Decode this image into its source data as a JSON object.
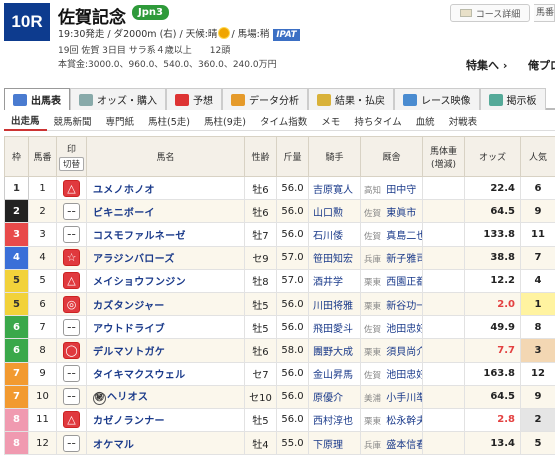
{
  "race": {
    "number": "10R",
    "name": "佐賀記念",
    "grade": "Jpn3",
    "info_line1": "19:30発走 / ダ2000m (右) / 天候:晴",
    "track": "/ 馬場:稍",
    "ipat": "IPAT",
    "info_line2": "19回 佐賀 3日目 サラ系４歳以上　　12頭",
    "info_line3": "本賞金:3000.0、960.0、540.0、360.0、240.0万円"
  },
  "buttons": {
    "course": "コース詳細",
    "umaban": "馬番",
    "tokushu": "特集へ",
    "ore": "俺プロ"
  },
  "tabs": [
    {
      "label": "出馬表",
      "color": "#4a7bd0"
    },
    {
      "label": "オッズ・購入",
      "color": "#8aa"
    },
    {
      "label": "予想",
      "color": "#d33"
    },
    {
      "label": "データ分析",
      "color": "#e59a2a"
    },
    {
      "label": "結果・払戻",
      "color": "#d9b23a"
    },
    {
      "label": "レース映像",
      "color": "#4a8bd0"
    },
    {
      "label": "掲示板",
      "color": "#5a9"
    }
  ],
  "subtabs": [
    "出走馬",
    "競馬新聞",
    "専門紙",
    "馬柱(5走)",
    "馬柱(9走)",
    "タイム指数",
    "メモ",
    "持ちタイム",
    "血統",
    "対戦表"
  ],
  "columns": {
    "waku": "枠",
    "umaban": "馬番",
    "mark": "印",
    "mark_sub": "切替",
    "horse": "馬名",
    "sex_age": "性齢",
    "weight": "斤量",
    "jockey": "騎手",
    "trainer": "厩舎",
    "body": "馬体重",
    "body_sub": "(増減)",
    "odds": "オッズ",
    "pop": "人気"
  },
  "entries": [
    {
      "waku": "1",
      "umaban": "1",
      "mark": "△",
      "mark_red": true,
      "tag": "",
      "horse": "ユメノホノオ",
      "sex_age": "牡6",
      "weight": "56.0",
      "jockey": "吉原寛人",
      "area": "高知",
      "trainer": "田中守",
      "odds": "22.4",
      "odds_red": false,
      "pop": "6",
      "wcolor": "#ffffff",
      "wtext": "#333"
    },
    {
      "waku": "2",
      "umaban": "2",
      "mark": "--",
      "mark_red": false,
      "tag": "",
      "horse": "ビキニボーイ",
      "sex_age": "牡6",
      "weight": "56.0",
      "jockey": "山口勲",
      "area": "佐賀",
      "trainer": "東眞市",
      "odds": "64.5",
      "odds_red": false,
      "pop": "9",
      "wcolor": "#222222",
      "wtext": "#fff"
    },
    {
      "waku": "3",
      "umaban": "3",
      "mark": "--",
      "mark_red": false,
      "tag": "",
      "horse": "コスモファルネーゼ",
      "sex_age": "牡7",
      "weight": "56.0",
      "jockey": "石川倭",
      "area": "佐賀",
      "trainer": "真島二也",
      "odds": "133.8",
      "odds_red": false,
      "pop": "11",
      "wcolor": "#e84a4a",
      "wtext": "#fff"
    },
    {
      "waku": "4",
      "umaban": "4",
      "mark": "☆",
      "mark_red": true,
      "tag": "",
      "horse": "アラジンバローズ",
      "sex_age": "セ9",
      "weight": "57.0",
      "jockey": "笹田知宏",
      "area": "兵庫",
      "trainer": "新子雅司",
      "odds": "38.8",
      "odds_red": false,
      "pop": "7",
      "wcolor": "#3a6fd8",
      "wtext": "#fff"
    },
    {
      "waku": "5",
      "umaban": "5",
      "mark": "△",
      "mark_red": true,
      "tag": "",
      "horse": "メイショウフンジン",
      "sex_age": "牡8",
      "weight": "57.0",
      "jockey": "酒井学",
      "area": "栗東",
      "trainer": "西園正都",
      "odds": "12.2",
      "odds_red": false,
      "pop": "4",
      "wcolor": "#f2d23a",
      "wtext": "#333"
    },
    {
      "waku": "5",
      "umaban": "6",
      "mark": "◎",
      "mark_red": true,
      "tag": "",
      "horse": "カズタンジャー",
      "sex_age": "牡5",
      "weight": "56.0",
      "jockey": "川田将雅",
      "area": "栗東",
      "trainer": "新谷功一",
      "odds": "2.0",
      "odds_red": true,
      "pop": "1",
      "wcolor": "#f2d23a",
      "wtext": "#333"
    },
    {
      "waku": "6",
      "umaban": "7",
      "mark": "--",
      "mark_red": false,
      "tag": "",
      "horse": "アウトドライブ",
      "sex_age": "牡5",
      "weight": "56.0",
      "jockey": "飛田愛斗",
      "area": "佐賀",
      "trainer": "池田忠好",
      "odds": "49.9",
      "odds_red": false,
      "pop": "8",
      "wcolor": "#3aa84a",
      "wtext": "#fff"
    },
    {
      "waku": "6",
      "umaban": "8",
      "mark": "◯",
      "mark_red": true,
      "tag": "",
      "horse": "デルマソトガケ",
      "sex_age": "牡6",
      "weight": "58.0",
      "jockey": "團野大成",
      "area": "栗東",
      "trainer": "須貝尚介",
      "odds": "7.7",
      "odds_red": true,
      "pop": "3",
      "wcolor": "#3aa84a",
      "wtext": "#fff"
    },
    {
      "waku": "7",
      "umaban": "9",
      "mark": "--",
      "mark_red": false,
      "tag": "",
      "horse": "タイキマクスウェル",
      "sex_age": "セ7",
      "weight": "56.0",
      "jockey": "金山昇馬",
      "area": "佐賀",
      "trainer": "池田忠好",
      "odds": "163.8",
      "odds_red": false,
      "pop": "12",
      "wcolor": "#f29a30",
      "wtext": "#fff"
    },
    {
      "waku": "7",
      "umaban": "10",
      "mark": "--",
      "mark_red": false,
      "tag": "㊙",
      "horse": "ヘリオス",
      "sex_age": "セ10",
      "weight": "56.0",
      "jockey": "原優介",
      "area": "美浦",
      "trainer": "小手川準",
      "odds": "64.5",
      "odds_red": false,
      "pop": "9",
      "wcolor": "#f29a30",
      "wtext": "#fff"
    },
    {
      "waku": "8",
      "umaban": "11",
      "mark": "△",
      "mark_red": true,
      "tag": "",
      "horse": "カゼノランナー",
      "sex_age": "牡5",
      "weight": "56.0",
      "jockey": "西村淳也",
      "area": "栗東",
      "trainer": "松永幹夫",
      "odds": "2.8",
      "odds_red": true,
      "pop": "2",
      "wcolor": "#f09ab0",
      "wtext": "#fff"
    },
    {
      "waku": "8",
      "umaban": "12",
      "mark": "--",
      "mark_red": false,
      "tag": "",
      "horse": "オケマル",
      "sex_age": "牡4",
      "weight": "55.0",
      "jockey": "下原理",
      "area": "兵庫",
      "trainer": "盛本信春",
      "odds": "13.4",
      "odds_red": false,
      "pop": "5",
      "wcolor": "#f09ab0",
      "wtext": "#fff"
    }
  ]
}
